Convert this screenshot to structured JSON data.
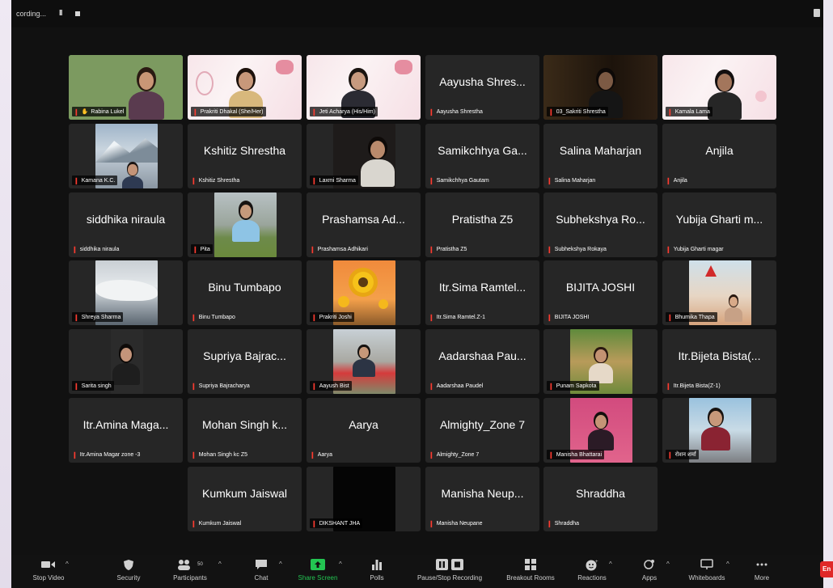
{
  "recording": {
    "label": "cording...",
    "pause_icon": "pause-icon",
    "stop_icon": "stop-icon"
  },
  "view_icon": "view-icon",
  "participants": [
    {
      "tile": "Rabina Lukel",
      "video": true,
      "caption": "Rabina Lukel",
      "active": true,
      "host_icon": true
    },
    {
      "tile": "Prakriti Dhakal (She/Her)",
      "video": true,
      "caption": "Prakriti Dhakal (She/Her)"
    },
    {
      "tile": "Jeti Acharya (His/Him)",
      "video": true,
      "caption": "Jeti Acharya (His/Him)"
    },
    {
      "tile": "Aayusha Shres...",
      "video": false,
      "caption": "Aayusha Shrestha"
    },
    {
      "tile": "03_Sakriti Shrestha",
      "video": true,
      "caption": "03_Sakriti Shrestha"
    },
    {
      "tile": "Kamala Lama",
      "video": true,
      "caption": "Kamala Lama"
    },
    {
      "tile": "Kamana K.C.",
      "video": true,
      "caption": "Kamana K.C."
    },
    {
      "tile": "Kshitiz Shrestha",
      "video": false,
      "caption": "Kshitiz Shrestha"
    },
    {
      "tile": "Laxmi Sharma",
      "video": true,
      "caption": "Laxmi Sharma"
    },
    {
      "tile": "Samikchhya Ga...",
      "video": false,
      "caption": "Samikchhya Gautam"
    },
    {
      "tile": "Salina Maharjan",
      "video": false,
      "caption": "Salina Maharjan"
    },
    {
      "tile": "Anjila",
      "video": false,
      "caption": "Anjila"
    },
    {
      "tile": "siddhika niraula",
      "video": false,
      "caption": "siddhika niraula"
    },
    {
      "tile": "Pita",
      "video": true,
      "caption": "Pita"
    },
    {
      "tile": "Prashamsa Ad...",
      "video": false,
      "caption": "Prashamsa Adhikari"
    },
    {
      "tile": "Pratistha Z5",
      "video": false,
      "caption": "Pratistha Z5"
    },
    {
      "tile": "Subhekshya Ro...",
      "video": false,
      "caption": "Subhekshya Rokaya"
    },
    {
      "tile": "Yubija Gharti m...",
      "video": false,
      "caption": "Yubija Gharti magar"
    },
    {
      "tile": "Shreya Sharma",
      "video": true,
      "caption": "Shreya Sharma"
    },
    {
      "tile": "Binu Tumbapo",
      "video": false,
      "caption": "Binu Tumbapo"
    },
    {
      "tile": "Prakriti Joshi",
      "video": true,
      "caption": "Prakriti Joshi"
    },
    {
      "tile": "Itr.Sima Ramtel...",
      "video": false,
      "caption": "Itr.Sima Ramtel.Z-1"
    },
    {
      "tile": "BIJITA JOSHI",
      "video": false,
      "caption": "BIJITA JOSHI"
    },
    {
      "tile": "Bhumika Thapa",
      "video": true,
      "caption": "Bhumika Thapa"
    },
    {
      "tile": "Sarita singh",
      "video": true,
      "caption": "Sarita singh"
    },
    {
      "tile": "Supriya Bajrac...",
      "video": false,
      "caption": "Supriya Bajracharya"
    },
    {
      "tile": "Aayush Bist",
      "video": true,
      "caption": "Aayush Bist"
    },
    {
      "tile": "Aadarshaa Pau...",
      "video": false,
      "caption": "Aadarshaa Paudel"
    },
    {
      "tile": "Punam Sapkota",
      "video": true,
      "caption": "Punam Sapkota"
    },
    {
      "tile": "Itr.Bijeta Bista(...",
      "video": false,
      "caption": "Itr.Bijeta Bista(Z-1)"
    },
    {
      "tile": "Itr.Amina Maga...",
      "video": false,
      "caption": "Itr.Amina Magar zone -3"
    },
    {
      "tile": "Mohan Singh k...",
      "video": false,
      "caption": "Mohan Singh kc Z5"
    },
    {
      "tile": "Aarya",
      "video": false,
      "caption": "Aarya"
    },
    {
      "tile": "Almighty_Zone 7",
      "video": false,
      "caption": "Almighty_Zone 7"
    },
    {
      "tile": "Manisha Bhattarai",
      "video": true,
      "caption": "Manisha Bhattarai"
    },
    {
      "tile": "रोशन शर्मा",
      "video": true,
      "caption": "रोशन शर्मा"
    },
    {
      "tile": "Kumkum Jaiswal",
      "video": false,
      "caption": "Kumkum Jaiswal"
    },
    {
      "tile": "DIKSHANT JHA",
      "video": true,
      "caption": "DIKSHANT JHA"
    },
    {
      "tile": "Manisha Neup...",
      "video": false,
      "caption": "Manisha Neupane"
    },
    {
      "tile": "Shraddha",
      "video": false,
      "caption": "Shraddha"
    }
  ],
  "toolbar": {
    "stop_video": "Stop Video",
    "security": "Security",
    "participants": "Participants",
    "participants_count": "50",
    "chat": "Chat",
    "share_screen": "Share Screen",
    "polls": "Polls",
    "pause_stop_recording": "Pause/Stop Recording",
    "breakout_rooms": "Breakout Rooms",
    "reactions": "Reactions",
    "apps": "Apps",
    "whiteboards": "Whiteboards",
    "more": "More",
    "end": "En"
  },
  "colors": {
    "app_bg": "#111111",
    "tile_bg": "#262626",
    "active_speaker": "#23c552",
    "muted": "#ff3b30",
    "share_screen": "#23c552"
  }
}
